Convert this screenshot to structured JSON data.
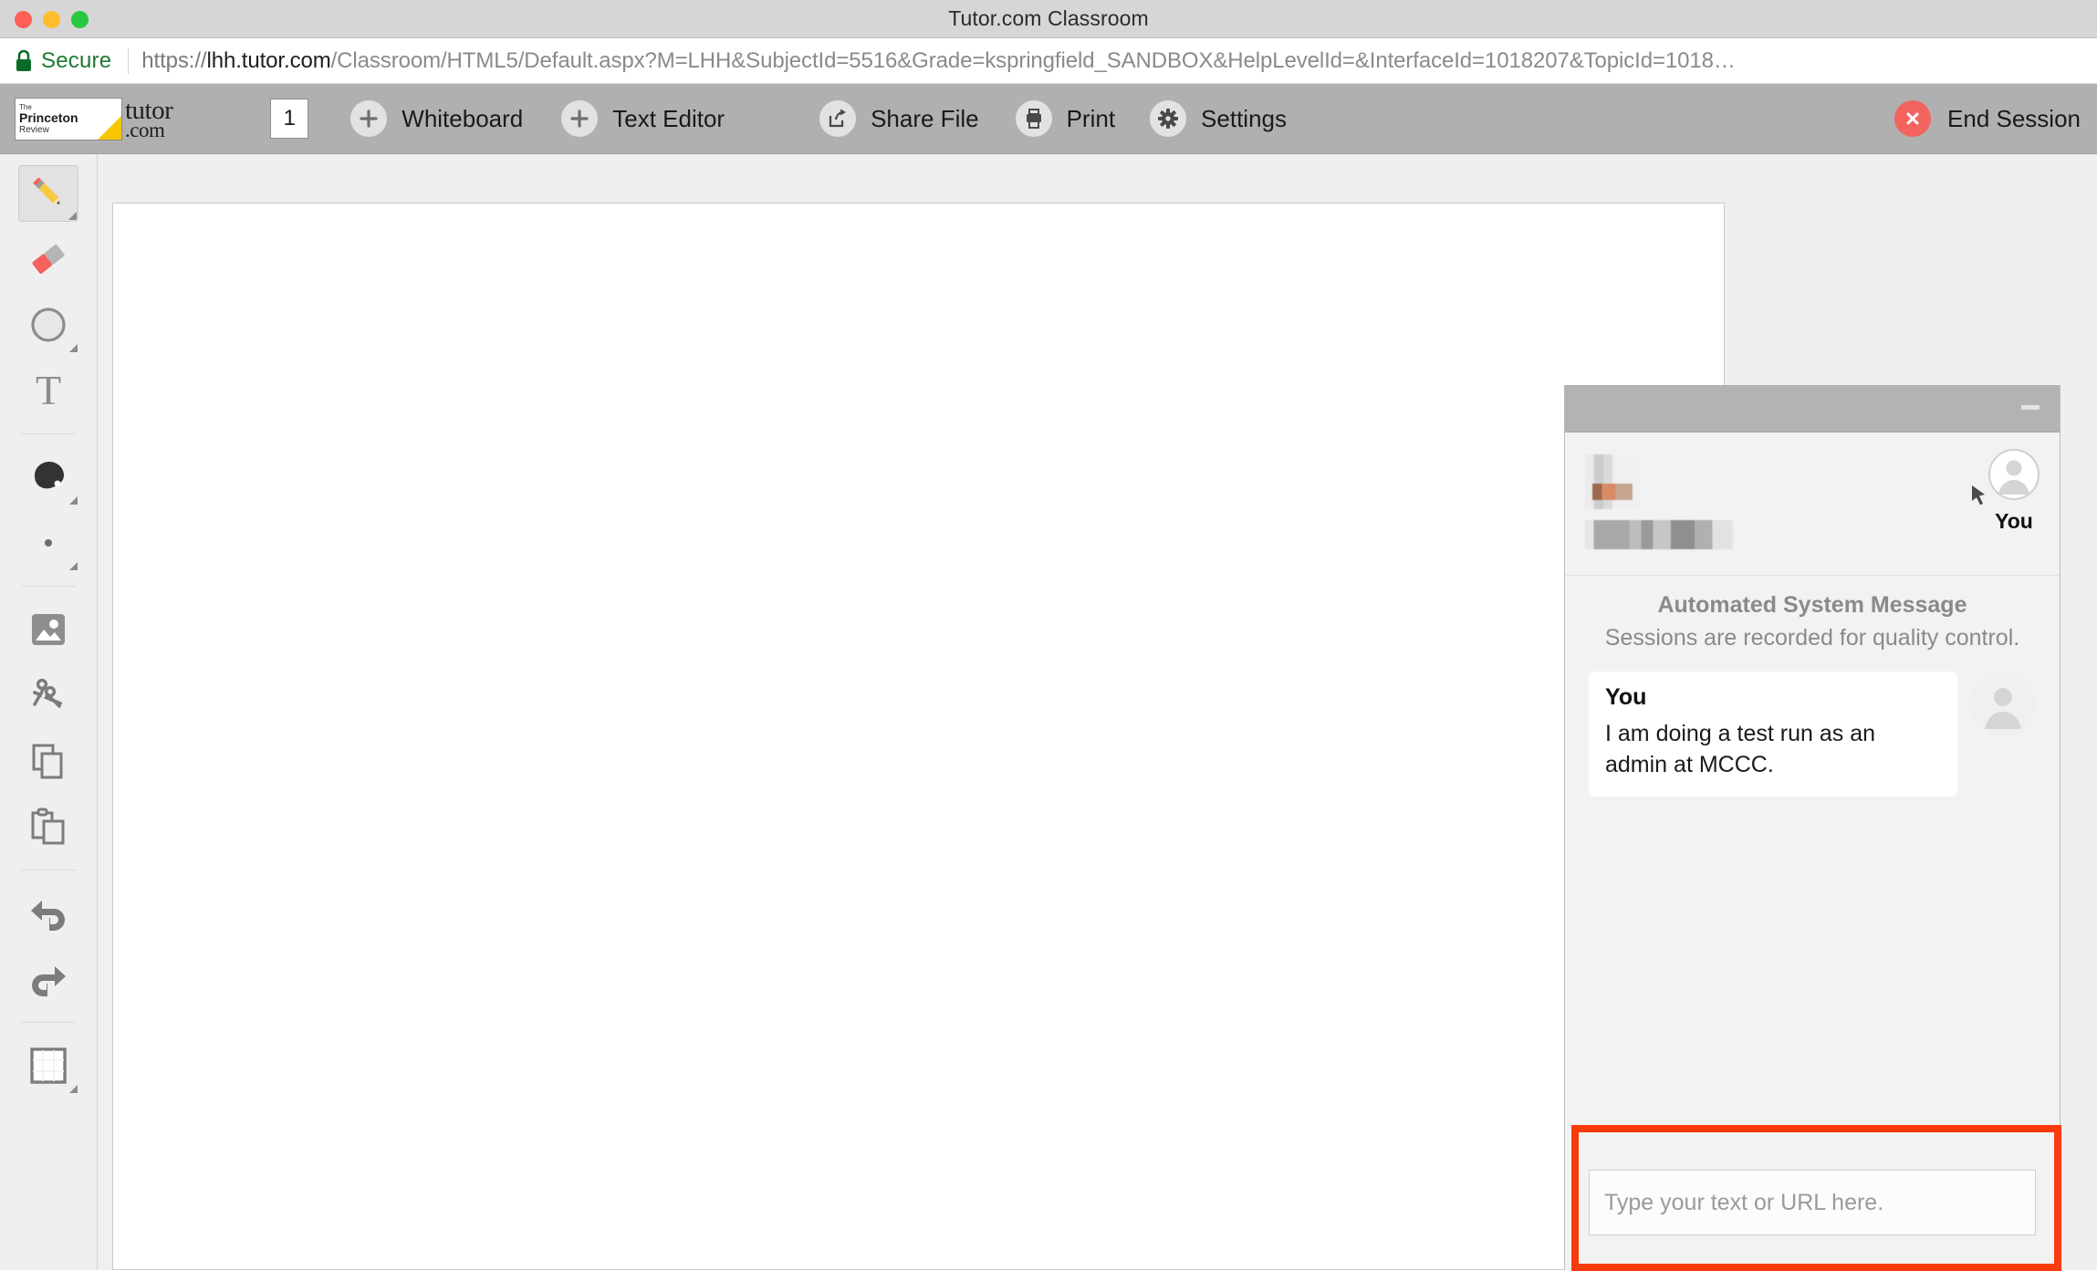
{
  "window": {
    "title": "Tutor.com Classroom",
    "traffic_lights": [
      "close",
      "minimize",
      "zoom"
    ]
  },
  "browser": {
    "security_label": "Secure",
    "lock_icon": "lock-icon",
    "url": {
      "scheme": "https://",
      "host": "lhh.tutor.com",
      "path": "/Classroom/HTML5/Default.aspx?M=LHH&SubjectId=5516&Grade=kspringfield_SANDBOX&HelpLevelId=&InterfaceId=1018207&TopicId=1018…",
      "full": "https://lhh.tutor.com/Classroom/HTML5/Default.aspx?M=LHH&SubjectId=5516&Grade=kspringfield_SANDBOX&HelpLevelId=&InterfaceId=1018207&TopicId=1018…"
    }
  },
  "toolbar": {
    "logo": {
      "pr_the": "The",
      "pr_princeton": "Princeton",
      "pr_review": "Review",
      "tutor": "tutor",
      "dotcom": ".com"
    },
    "page_number": "1",
    "buttons": [
      {
        "label": "Whiteboard",
        "icon": "plus-icon"
      },
      {
        "label": "Text Editor",
        "icon": "plus-icon"
      },
      {
        "label": "Share File",
        "icon": "share-icon"
      },
      {
        "label": "Print",
        "icon": "printer-icon"
      },
      {
        "label": "Settings",
        "icon": "gear-icon"
      }
    ],
    "end_session": {
      "label": "End Session",
      "icon": "close-circle-icon",
      "color": "#f3645e"
    }
  },
  "tools": [
    {
      "name": "pencil-tool",
      "icon": "pencil-icon",
      "selected": true,
      "has_corner": true
    },
    {
      "name": "eraser-tool",
      "icon": "eraser-icon",
      "selected": false,
      "has_corner": false
    },
    {
      "name": "shape-tool",
      "icon": "circle-icon",
      "selected": false,
      "has_corner": true
    },
    {
      "name": "text-tool",
      "icon": "text-t-icon",
      "selected": false,
      "has_corner": false
    },
    {
      "name": "color-tool",
      "icon": "color-blob-icon",
      "selected": false,
      "has_corner": true
    },
    {
      "name": "stroke-width-tool",
      "icon": "dot-icon",
      "selected": false,
      "has_corner": true
    },
    {
      "name": "image-tool",
      "icon": "image-icon",
      "selected": false,
      "has_corner": false
    },
    {
      "name": "cut-tool",
      "icon": "scissors-icon",
      "selected": false,
      "has_corner": false
    },
    {
      "name": "copy-tool",
      "icon": "copy-icon",
      "selected": false,
      "has_corner": false
    },
    {
      "name": "paste-tool",
      "icon": "paste-icon",
      "selected": false,
      "has_corner": false
    },
    {
      "name": "undo-tool",
      "icon": "undo-arrow-icon",
      "selected": false,
      "has_corner": false
    },
    {
      "name": "redo-tool",
      "icon": "redo-arrow-icon",
      "selected": false,
      "has_corner": false
    },
    {
      "name": "background-tool",
      "icon": "grid-square-icon",
      "selected": false,
      "has_corner": true
    }
  ],
  "chat": {
    "minimize_icon": "minimize-icon",
    "participants": {
      "peer": {
        "name_redacted": true,
        "avatar": "pixelated-photo-avatar"
      },
      "self": {
        "label": "You",
        "avatar": "person-silhouette-icon"
      }
    },
    "system_message": {
      "title": "Automated System Message",
      "text": "Sessions are recorded for quality control."
    },
    "messages": [
      {
        "author": "You",
        "text": "I am doing a test run as an admin at MCCC.",
        "avatar": "person-silhouette-icon"
      }
    ],
    "input": {
      "value": "",
      "placeholder": "Type your text or URL here."
    }
  },
  "annotation": {
    "highlight_color": "#f93a0a",
    "target": "chat-input-area"
  }
}
